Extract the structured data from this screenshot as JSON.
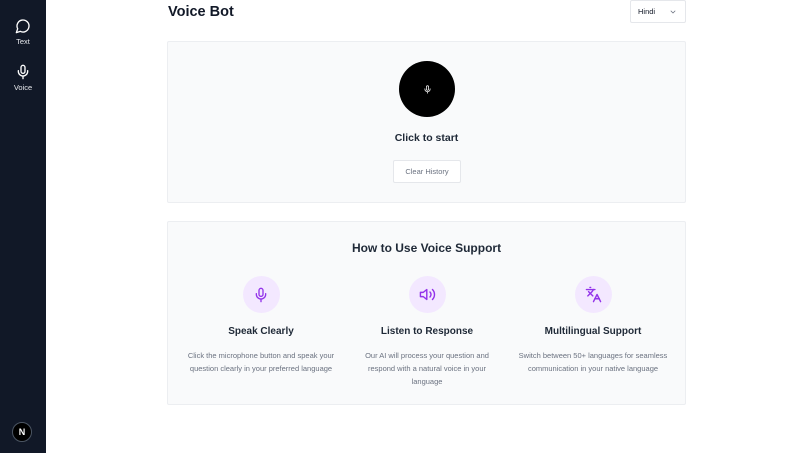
{
  "sidebar": {
    "items": [
      {
        "label": "Text",
        "icon": "chat-bubble-icon"
      },
      {
        "label": "Voice",
        "icon": "microphone-icon"
      }
    ],
    "badge": "N"
  },
  "header": {
    "title": "Voice Bot",
    "language": {
      "selected": "Hindi"
    }
  },
  "recorder": {
    "start_label": "Click to start",
    "clear_label": "Clear History"
  },
  "help": {
    "title": "How to Use Voice Support",
    "features": [
      {
        "title": "Speak Clearly",
        "desc": "Click the microphone button and speak your question clearly in your preferred language",
        "icon": "microphone-icon"
      },
      {
        "title": "Listen to Response",
        "desc": "Our AI will process your question and respond with a natural voice in your language",
        "icon": "speaker-icon"
      },
      {
        "title": "Multilingual Support",
        "desc": "Switch between 50+ languages for seamless communication in your native language",
        "icon": "translate-icon"
      }
    ]
  },
  "colors": {
    "sidebar_bg": "#111827",
    "accent": "#9333ea",
    "icon_bg": "#f3e8ff"
  }
}
